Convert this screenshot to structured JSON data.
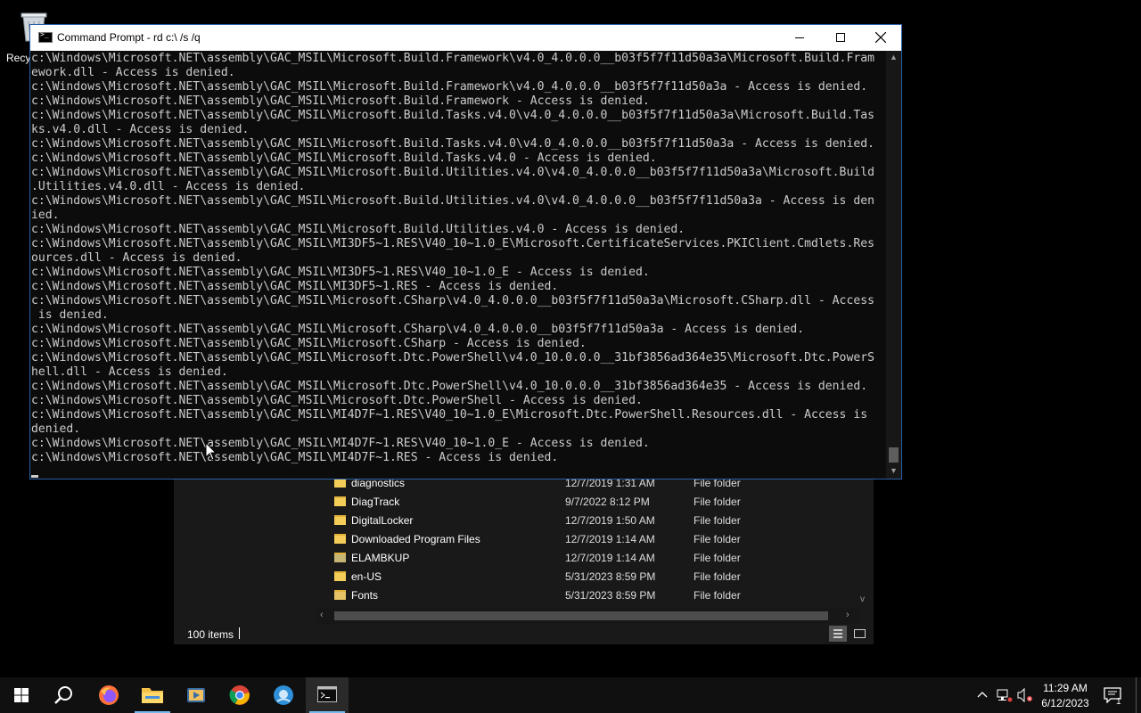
{
  "desktop": {
    "recycle_bin_label": "Recyc"
  },
  "explorer": {
    "files": [
      {
        "name": "diagnostics",
        "date": "12/7/2019 1:31 AM",
        "type": "File folder",
        "icon": "folder-icon"
      },
      {
        "name": "DiagTrack",
        "date": "9/7/2022 8:12 PM",
        "type": "File folder",
        "icon": "folder-icon"
      },
      {
        "name": "DigitalLocker",
        "date": "12/7/2019 1:50 AM",
        "type": "File folder",
        "icon": "folder-icon"
      },
      {
        "name": "Downloaded Program Files",
        "date": "12/7/2019 1:14 AM",
        "type": "File folder",
        "icon": "folder-icon"
      },
      {
        "name": "ELAMBKUP",
        "date": "12/7/2019 1:14 AM",
        "type": "File folder",
        "icon": "system-folder-icon"
      },
      {
        "name": "en-US",
        "date": "5/31/2023 8:59 PM",
        "type": "File folder",
        "icon": "folder-icon"
      },
      {
        "name": "Fonts",
        "date": "5/31/2023 8:59 PM",
        "type": "File folder",
        "icon": "fonts-folder-icon"
      }
    ],
    "status": {
      "item_count": "100 items"
    }
  },
  "cmd": {
    "title": "Command Prompt - rd  c:\\ /s /q",
    "lines": [
      "c:\\Windows\\Microsoft.NET\\assembly\\GAC_MSIL\\Microsoft.Build.Framework\\v4.0_4.0.0.0__b03f5f7f11d50a3a\\Microsoft.Build.Fram",
      "ework.dll - Access is denied.",
      "c:\\Windows\\Microsoft.NET\\assembly\\GAC_MSIL\\Microsoft.Build.Framework\\v4.0_4.0.0.0__b03f5f7f11d50a3a - Access is denied.",
      "c:\\Windows\\Microsoft.NET\\assembly\\GAC_MSIL\\Microsoft.Build.Framework - Access is denied.",
      "c:\\Windows\\Microsoft.NET\\assembly\\GAC_MSIL\\Microsoft.Build.Tasks.v4.0\\v4.0_4.0.0.0__b03f5f7f11d50a3a\\Microsoft.Build.Tas",
      "ks.v4.0.dll - Access is denied.",
      "c:\\Windows\\Microsoft.NET\\assembly\\GAC_MSIL\\Microsoft.Build.Tasks.v4.0\\v4.0_4.0.0.0__b03f5f7f11d50a3a - Access is denied.",
      "c:\\Windows\\Microsoft.NET\\assembly\\GAC_MSIL\\Microsoft.Build.Tasks.v4.0 - Access is denied.",
      "c:\\Windows\\Microsoft.NET\\assembly\\GAC_MSIL\\Microsoft.Build.Utilities.v4.0\\v4.0_4.0.0.0__b03f5f7f11d50a3a\\Microsoft.Build",
      ".Utilities.v4.0.dll - Access is denied.",
      "c:\\Windows\\Microsoft.NET\\assembly\\GAC_MSIL\\Microsoft.Build.Utilities.v4.0\\v4.0_4.0.0.0__b03f5f7f11d50a3a - Access is den",
      "ied.",
      "c:\\Windows\\Microsoft.NET\\assembly\\GAC_MSIL\\Microsoft.Build.Utilities.v4.0 - Access is denied.",
      "c:\\Windows\\Microsoft.NET\\assembly\\GAC_MSIL\\MI3DF5~1.RES\\V40_10~1.0_E\\Microsoft.CertificateServices.PKIClient.Cmdlets.Res",
      "ources.dll - Access is denied.",
      "c:\\Windows\\Microsoft.NET\\assembly\\GAC_MSIL\\MI3DF5~1.RES\\V40_10~1.0_E - Access is denied.",
      "c:\\Windows\\Microsoft.NET\\assembly\\GAC_MSIL\\MI3DF5~1.RES - Access is denied.",
      "c:\\Windows\\Microsoft.NET\\assembly\\GAC_MSIL\\Microsoft.CSharp\\v4.0_4.0.0.0__b03f5f7f11d50a3a\\Microsoft.CSharp.dll - Access",
      " is denied.",
      "c:\\Windows\\Microsoft.NET\\assembly\\GAC_MSIL\\Microsoft.CSharp\\v4.0_4.0.0.0__b03f5f7f11d50a3a - Access is denied.",
      "c:\\Windows\\Microsoft.NET\\assembly\\GAC_MSIL\\Microsoft.CSharp - Access is denied.",
      "c:\\Windows\\Microsoft.NET\\assembly\\GAC_MSIL\\Microsoft.Dtc.PowerShell\\v4.0_10.0.0.0__31bf3856ad364e35\\Microsoft.Dtc.PowerS",
      "hell.dll - Access is denied.",
      "c:\\Windows\\Microsoft.NET\\assembly\\GAC_MSIL\\Microsoft.Dtc.PowerShell\\v4.0_10.0.0.0__31bf3856ad364e35 - Access is denied.",
      "c:\\Windows\\Microsoft.NET\\assembly\\GAC_MSIL\\Microsoft.Dtc.PowerShell - Access is denied.",
      "c:\\Windows\\Microsoft.NET\\assembly\\GAC_MSIL\\MI4D7F~1.RES\\V40_10~1.0_E\\Microsoft.Dtc.PowerShell.Resources.dll - Access is",
      "denied.",
      "c:\\Windows\\Microsoft.NET\\assembly\\GAC_MSIL\\MI4D7F~1.RES\\V40_10~1.0_E - Access is denied.",
      "c:\\Windows\\Microsoft.NET\\assembly\\GAC_MSIL\\MI4D7F~1.RES - Access is denied."
    ]
  },
  "taskbar": {
    "items": [
      {
        "name": "start-button",
        "icon": "windows-logo-icon"
      },
      {
        "name": "search-button",
        "icon": "search-icon"
      },
      {
        "name": "firefox-button",
        "icon": "firefox-icon"
      },
      {
        "name": "file-explorer-button",
        "icon": "folder-icon"
      },
      {
        "name": "media-player-button",
        "icon": "media-icon"
      },
      {
        "name": "chrome-button",
        "icon": "chrome-icon"
      },
      {
        "name": "app-button",
        "icon": "app-icon"
      },
      {
        "name": "command-prompt-button",
        "icon": "terminal-icon"
      }
    ],
    "clock_time": "11:29 AM",
    "clock_date": "6/12/2023",
    "notification_count": "1"
  },
  "colors": {
    "console_bg": "#0c0c0c",
    "console_fg": "#cccccc",
    "accent": "#76b9ed"
  }
}
